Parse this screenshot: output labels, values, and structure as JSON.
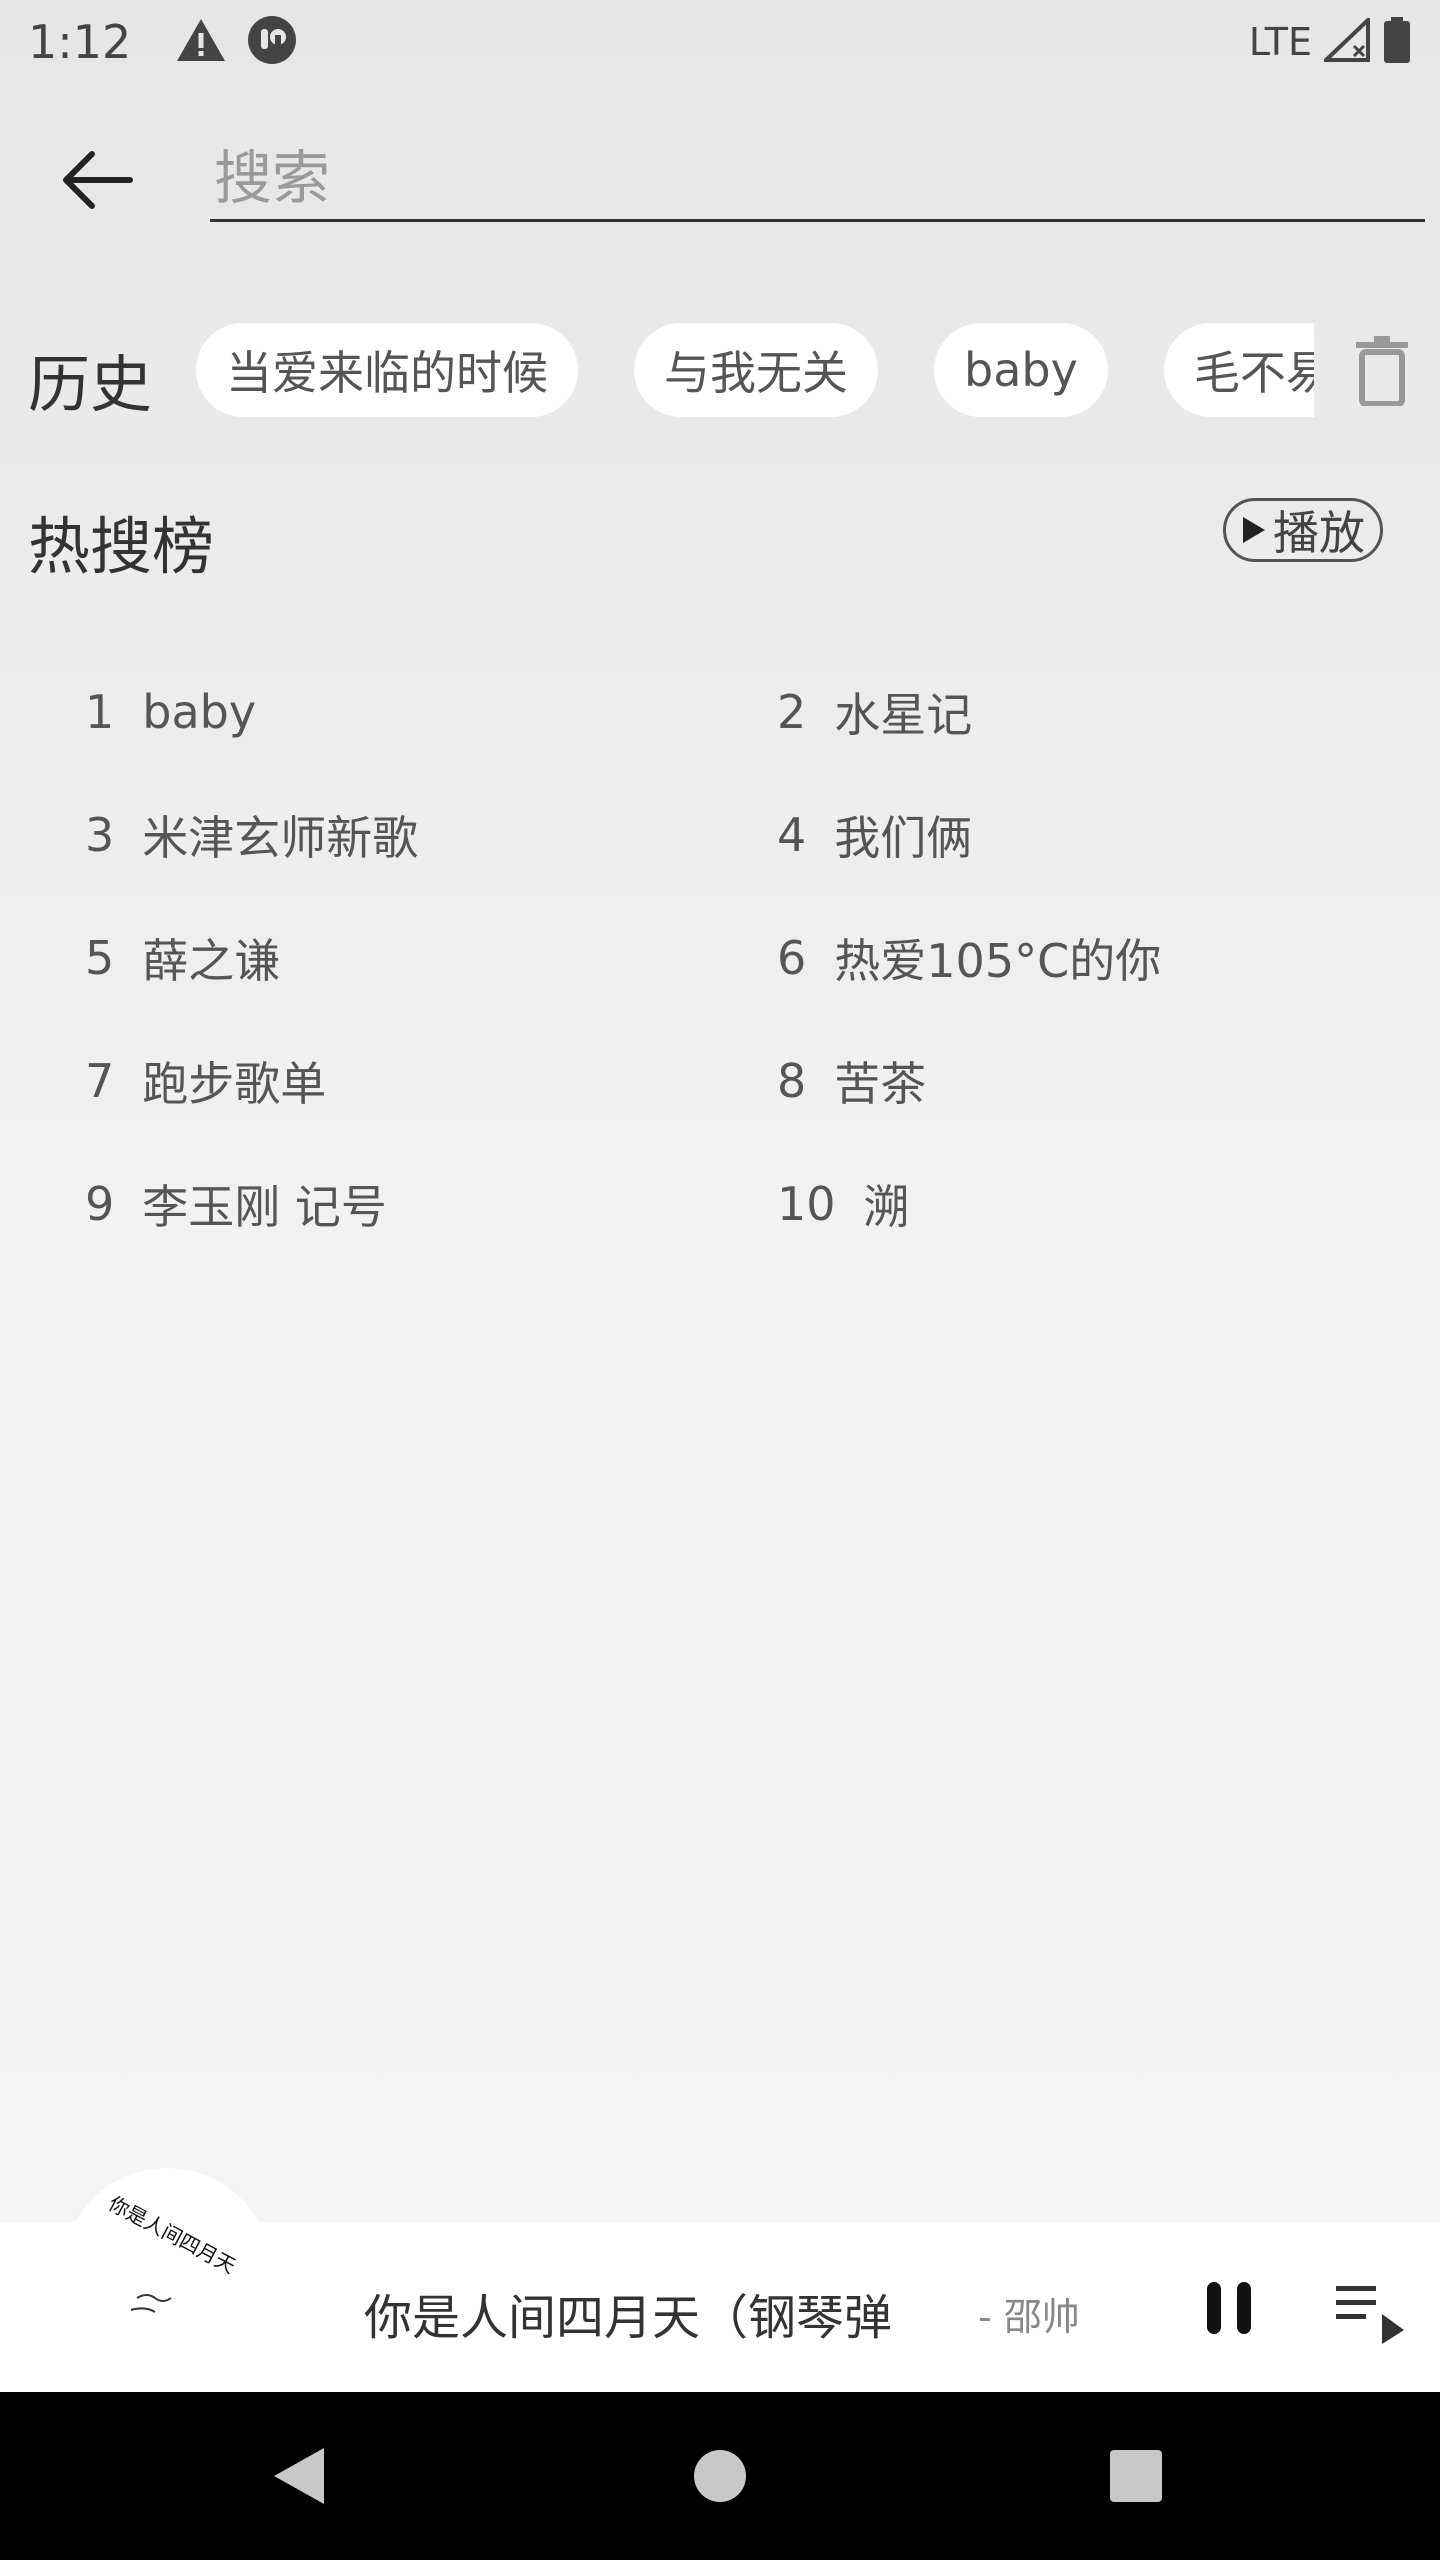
{
  "status_bar": {
    "time": "1:12",
    "network": "LTE",
    "icons": [
      "warning-icon",
      "app-notification-icon",
      "signal-icon",
      "battery-icon"
    ]
  },
  "search": {
    "placeholder": "搜索",
    "value": ""
  },
  "history": {
    "title": "历史",
    "items": [
      "当爱来临的时候",
      "与我无关",
      "baby",
      "毛不易"
    ]
  },
  "hot": {
    "title": "热搜榜",
    "play_label": "播放",
    "items": [
      {
        "rank": "1",
        "label": "baby"
      },
      {
        "rank": "2",
        "label": "水星记"
      },
      {
        "rank": "3",
        "label": "米津玄师新歌"
      },
      {
        "rank": "4",
        "label": "我们俩"
      },
      {
        "rank": "5",
        "label": "薛之谦"
      },
      {
        "rank": "6",
        "label": "热爱105°C的你"
      },
      {
        "rank": "7",
        "label": "跑步歌单"
      },
      {
        "rank": "8",
        "label": "苦茶"
      },
      {
        "rank": "9",
        "label": "李玉刚 记号"
      },
      {
        "rank": "10",
        "label": "溯"
      }
    ]
  },
  "player": {
    "song": "你是人间四月天（钢琴弹",
    "artist": "- 邵帅",
    "album_art_text": "你是人间四月天"
  },
  "colors": {
    "accent": "#333333",
    "chip_bg": "#ffffff",
    "nav_bg": "#000000"
  }
}
